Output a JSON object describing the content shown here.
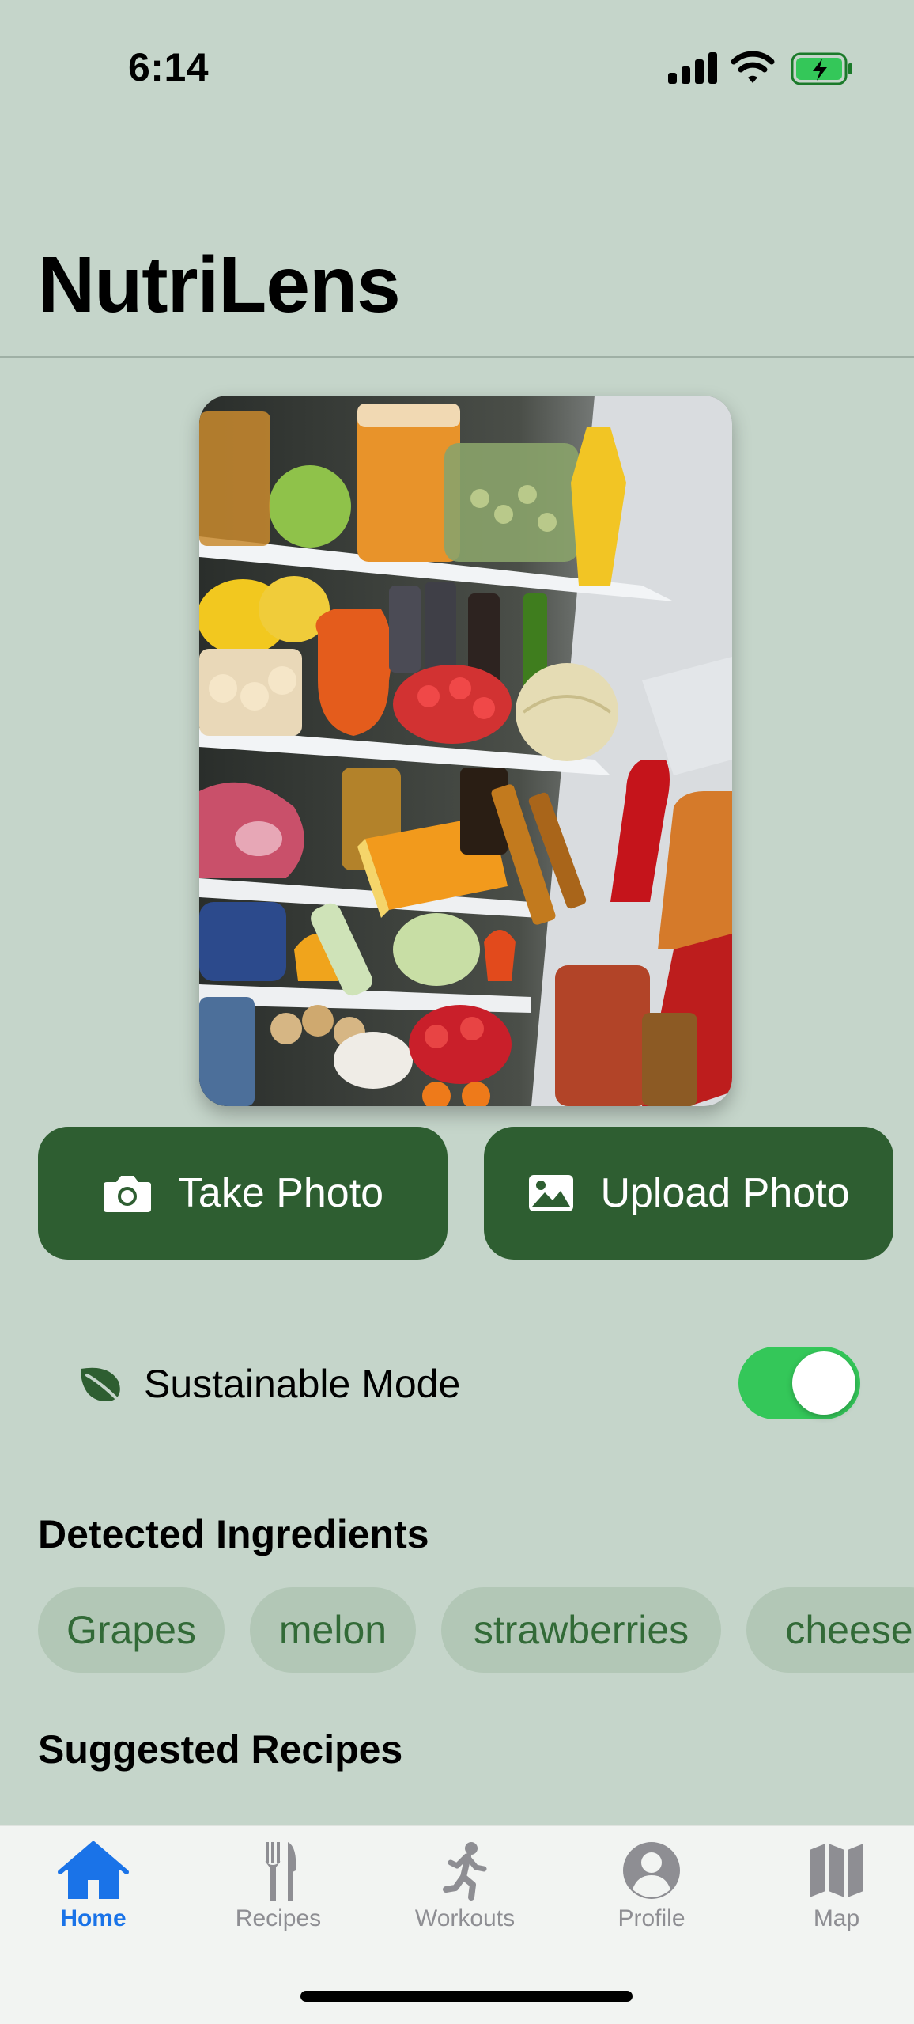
{
  "status_bar": {
    "time": "6:14"
  },
  "header": {
    "title": "NutriLens"
  },
  "actions": {
    "take_photo_label": "Take Photo",
    "upload_photo_label": "Upload Photo"
  },
  "sustainable_mode": {
    "label": "Sustainable Mode",
    "enabled": true
  },
  "detected": {
    "title": "Detected Ingredients",
    "ingredients": [
      "Grapes",
      "melon",
      "strawberries",
      "cheese"
    ]
  },
  "suggested": {
    "title": "Suggested Recipes"
  },
  "tabs": [
    {
      "label": "Home",
      "icon": "house-icon",
      "active": true
    },
    {
      "label": "Recipes",
      "icon": "fork-knife-icon",
      "active": false
    },
    {
      "label": "Workouts",
      "icon": "running-figure-icon",
      "active": false
    },
    {
      "label": "Profile",
      "icon": "person-circle-icon",
      "active": false
    },
    {
      "label": "Map",
      "icon": "map-icon",
      "active": false
    }
  ],
  "colors": {
    "background": "#c5d5ca",
    "button": "#2e5e31",
    "chip_bg": "#b2c7b6",
    "chip_text": "#326a37",
    "toggle_on": "#34c759",
    "tab_active": "#1a73e8",
    "tab_inactive": "#8e8e93"
  }
}
